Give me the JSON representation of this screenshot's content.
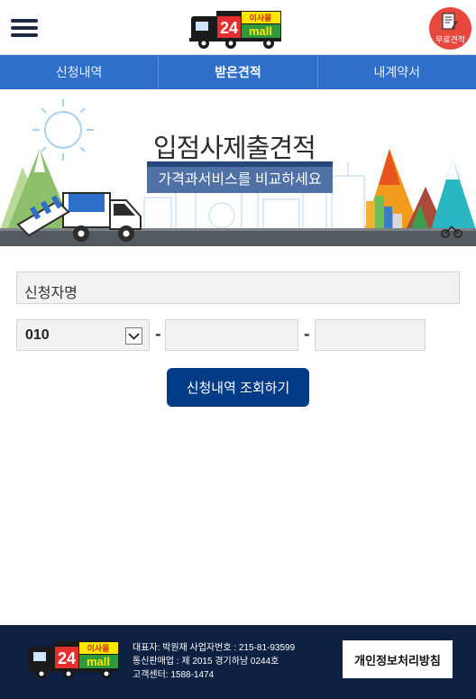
{
  "header": {
    "logo_brand": "이사몰",
    "logo_number": "24",
    "logo_mall": "mall",
    "quote_button_label": "무료견적"
  },
  "tabs": [
    {
      "label": "신청내역"
    },
    {
      "label": "받은견적"
    },
    {
      "label": "내계약서"
    }
  ],
  "banner": {
    "title": "입점사제출견적",
    "subtitle": "가격과서비스를 비교하세요"
  },
  "form": {
    "name_placeholder": "신청자명",
    "phone_prefix": "010",
    "dash": "-",
    "submit_label": "신청내역 조회하기"
  },
  "footer": {
    "line1": "대표자: 박원재  사업자번호 : 215-81-93599",
    "line2": "통신판매업 : 제 2015 경기하남 0244호",
    "line3": "고객센터: 1588-1474",
    "privacy_label": "개인정보처리방침"
  },
  "colors": {
    "tab_bar": "#2f6fca",
    "submit": "#043b86",
    "footer": "#0f2142",
    "quote_button": "#e8473e"
  }
}
